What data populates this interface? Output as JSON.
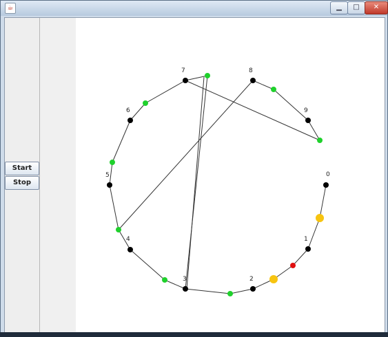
{
  "window": {
    "title": "",
    "controls": {
      "minimize": "▁",
      "maximize": "□",
      "close": "✕"
    },
    "app_icon": "java-cup-icon"
  },
  "sidebar": {
    "start_label": "Start",
    "stop_label": "Stop"
  },
  "ring": {
    "node_labels": [
      "0",
      "1",
      "2",
      "3",
      "4",
      "5",
      "6",
      "7",
      "8",
      "9"
    ],
    "colors": {
      "node": "#000000",
      "green": "#1fd12c",
      "yellow": "#f7c410",
      "red": "#e01010",
      "edge": "#333333"
    }
  }
}
